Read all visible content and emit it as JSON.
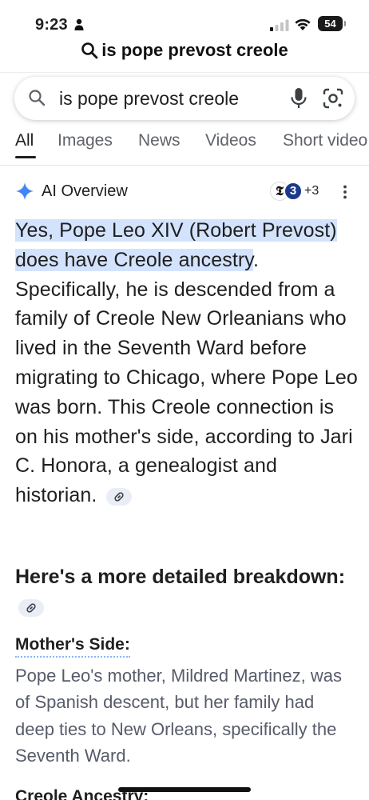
{
  "status_bar": {
    "time": "9:23",
    "battery": "54",
    "icons": [
      "person-icon",
      "signal-icon",
      "wifi-icon",
      "battery-icon"
    ]
  },
  "browser": {
    "url_text": "is pope prevost creole"
  },
  "search": {
    "query": "is pope prevost creole",
    "icons": [
      "search-icon",
      "mic-icon",
      "google-lens-icon"
    ]
  },
  "tabs": [
    {
      "label": "All",
      "active": true
    },
    {
      "label": "Images",
      "active": false
    },
    {
      "label": "News",
      "active": false
    },
    {
      "label": "Videos",
      "active": false
    },
    {
      "label": "Short video",
      "active": false
    }
  ],
  "ai_overview": {
    "title": "AI Overview",
    "source_badge_1": "𝕿",
    "source_badge_2": "3",
    "source_count": "+3",
    "highlighted_text": "Yes, Pope Leo XIV (Robert Prevost) does have Creole ancestry",
    "body_text": ". Specifically, he is descended from a family of Creole New Orleanians who lived in the Seventh Ward before migrating to Chicago, where Pope Leo was born. This Creole connection is on his mother's side, according to Jari C. Honora, a genealogist and historian.",
    "detail_heading": "Here's a more detailed breakdown:",
    "sections": [
      {
        "heading": "Mother's Side:",
        "text": "Pope Leo's mother, Mildred Martinez, was of Spanish descent, but her family had deep ties to New Orleans, specifically the Seventh Ward."
      },
      {
        "heading": "Creole Ancestry:"
      }
    ]
  },
  "colors": {
    "highlight": "#d3e3fd",
    "link_chip": "#e9eef6",
    "muted_text": "#575b6a",
    "sparkle_blue": "#4285f4"
  }
}
